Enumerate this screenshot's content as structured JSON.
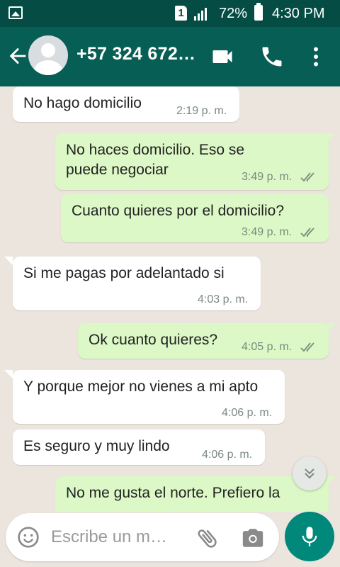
{
  "status_bar": {
    "sim_label": "1",
    "battery_percent": "72%",
    "time": "4:30 PM",
    "icons": [
      "image-icon",
      "sim-icon",
      "signal-icon",
      "battery-icon"
    ]
  },
  "header": {
    "contact_name": "+57 324 672…",
    "icons": [
      "back-arrow-icon",
      "avatar-icon",
      "video-call-icon",
      "phone-icon",
      "more-vert-icon"
    ]
  },
  "messages": [
    {
      "direction": "in",
      "text": "No hago domicilio",
      "time": "2:19 p. m."
    },
    {
      "direction": "out",
      "text": "No haces domicilio. Eso se puede negociar",
      "time": "3:49 p. m.",
      "read": true
    },
    {
      "direction": "out",
      "text": "Cuanto quieres por el domicilio?",
      "time": "3:49 p. m.",
      "read": true
    },
    {
      "direction": "in",
      "text": "Si me pagas por adelantado si",
      "time": "4:03 p. m."
    },
    {
      "direction": "out",
      "text": "Ok cuanto quieres?",
      "time": "4:05 p. m.",
      "read": true
    },
    {
      "direction": "in",
      "text": "Y porque mejor no vienes a mi apto",
      "time": "4:06 p. m."
    },
    {
      "direction": "in",
      "text": "Es seguro y muy lindo",
      "time": "4:06 p. m."
    },
    {
      "direction": "out",
      "text": "No me gusta el norte. Prefiero la",
      "time": ""
    }
  ],
  "composer": {
    "placeholder": "Escribe un m…",
    "icons": [
      "emoji-icon",
      "attach-icon",
      "camera-icon",
      "mic-icon",
      "scroll-down-icon"
    ]
  },
  "colors": {
    "app_bar": "#075e54",
    "status_bar": "#054d44",
    "chat_background": "#ece5dd",
    "incoming_bubble": "#ffffff",
    "outgoing_bubble": "#dcf8c6",
    "mic_button": "#00897b",
    "read_ticks": "#7b8a80"
  }
}
